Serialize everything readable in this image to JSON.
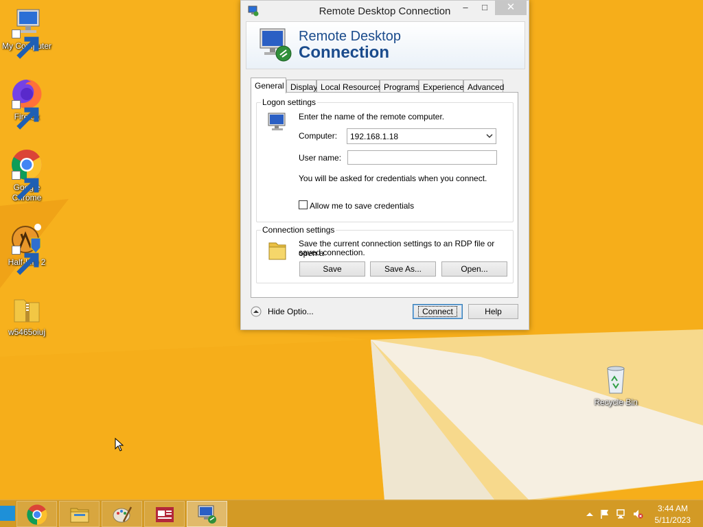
{
  "desktop": {
    "icons": [
      {
        "label": "My Computer",
        "icon": "computer-icon"
      },
      {
        "label": "Firefox",
        "icon": "firefox-icon"
      },
      {
        "label": "Google Chrome",
        "icon": "chrome-icon"
      },
      {
        "label": "Half-Life 2",
        "icon": "half-life-icon"
      },
      {
        "label": "w5465oiuj",
        "icon": "zip-folder-icon"
      },
      {
        "label": "Recycle Bin",
        "icon": "recycle-bin-icon"
      }
    ]
  },
  "window": {
    "title": "Remote Desktop Connection",
    "banner_line1": "Remote Desktop",
    "banner_line2": "Connection",
    "tabs": [
      "General",
      "Display",
      "Local Resources",
      "Programs",
      "Experience",
      "Advanced"
    ],
    "active_tab": "General",
    "logon": {
      "group_title": "Logon settings",
      "instruction": "Enter the name of the remote computer.",
      "computer_label": "Computer:",
      "computer_value": "192.168.1.18",
      "username_label": "User name:",
      "username_value": "",
      "credentials_note": "You will be asked for credentials when you connect.",
      "save_credentials_label": "Allow me to save credentials",
      "save_credentials_checked": false
    },
    "connection": {
      "group_title": "Connection settings",
      "description_line1": "Save the current connection settings to an RDP file or open a",
      "description_line2": "saved connection.",
      "save_label": "Save",
      "save_as_label": "Save As...",
      "open_label": "Open..."
    },
    "hide_options_label": "Hide Optio...",
    "connect_label": "Connect",
    "help_label": "Help"
  },
  "taskbar": {
    "apps": [
      "chrome-icon",
      "file-explorer-icon",
      "paint-icon",
      "media-player-icon",
      "remote-desktop-icon"
    ],
    "active_app": "remote-desktop-icon",
    "tray": [
      "show-hidden-icon",
      "action-center-flag-icon",
      "network-icon",
      "volume-muted-icon"
    ],
    "time": "3:44 AM",
    "date": "5/11/2023"
  },
  "colors": {
    "desktop_orange": "#f7b21c",
    "banner_text": "#1a4b8c",
    "taskbar": "#cd9628"
  }
}
